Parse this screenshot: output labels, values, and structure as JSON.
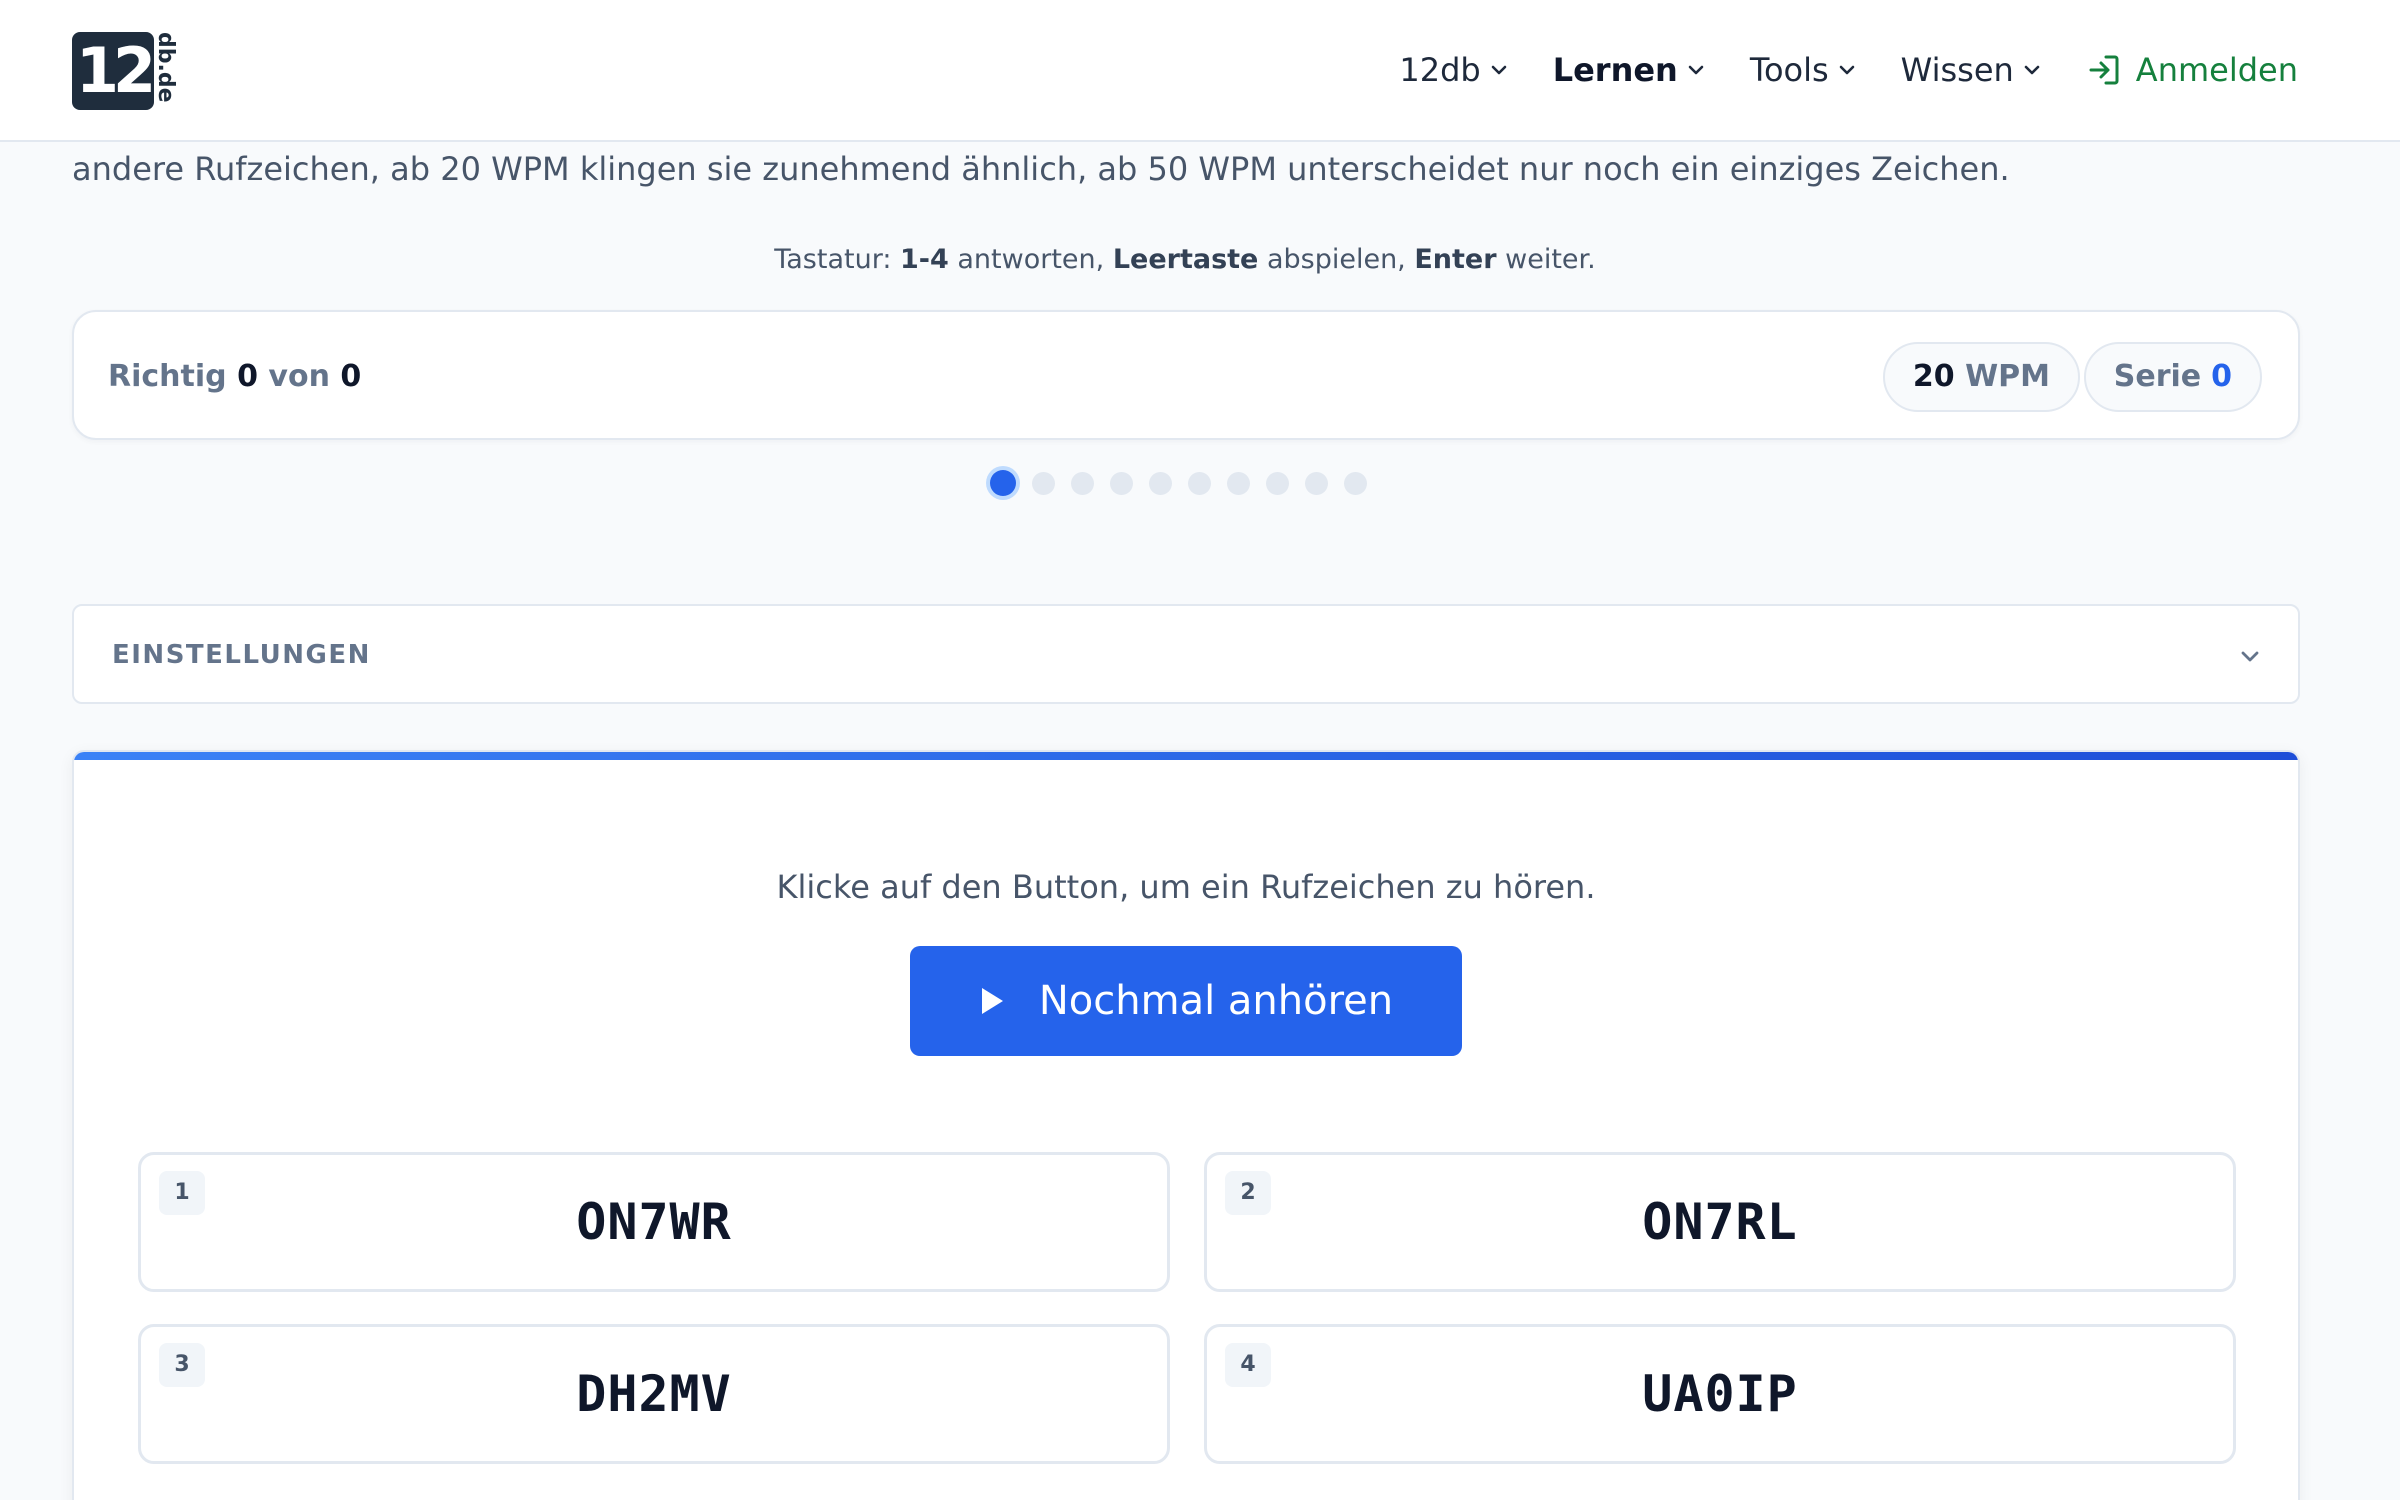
{
  "header": {
    "logo_number": "12",
    "logo_domain": "db.de",
    "nav": [
      {
        "label": "12db",
        "active": false
      },
      {
        "label": "Lernen",
        "active": true
      },
      {
        "label": "Tools",
        "active": false
      },
      {
        "label": "Wissen",
        "active": false
      }
    ],
    "login_label": "Anmelden"
  },
  "intro_text": "andere Rufzeichen, ab 20 WPM klingen sie zunehmend ähnlich, ab 50 WPM unterscheidet nur noch ein einziges Zeichen.",
  "keyboard_hint": {
    "prefix": "Tastatur: ",
    "k1": "1-4",
    "t1": " antworten, ",
    "k2": "Leertaste",
    "t2": " abspielen, ",
    "k3": "Enter",
    "t3": " weiter."
  },
  "score": {
    "label": "Richtig",
    "correct": "0",
    "of_label": "von",
    "total": "0",
    "wpm_value": "20",
    "wpm_unit": "WPM",
    "serie_label": "Serie",
    "serie_value": "0"
  },
  "progress": {
    "total_dots": 10,
    "current_index": 0
  },
  "settings": {
    "label": "EINSTELLUNGEN"
  },
  "quiz": {
    "instruction": "Klicke auf den Button, um ein Rufzeichen zu hören.",
    "play_label": "Nochmal anhören",
    "answers": [
      {
        "key": "1",
        "call": "ON7WR"
      },
      {
        "key": "2",
        "call": "ON7RL"
      },
      {
        "key": "3",
        "call": "DH2MV"
      },
      {
        "key": "4",
        "call": "UA0IP"
      }
    ]
  },
  "colors": {
    "accent": "#2563eb",
    "login": "#15803d",
    "logo_bg": "#1f2d3d"
  }
}
